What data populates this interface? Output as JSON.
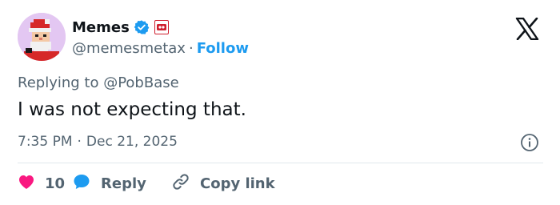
{
  "author": {
    "display_name": "Memes",
    "handle": "@memesmetax",
    "follow_label": "Follow",
    "separator": "·"
  },
  "tweet": {
    "replying_to": "Replying to @PobBase",
    "text": "I was not expecting that.",
    "time": "7:35 PM",
    "date": "Dec 21, 2025"
  },
  "actions": {
    "like_count": "10",
    "reply_label": "Reply",
    "copy_link_label": "Copy link"
  },
  "icons": {
    "verified": "verified-badge-icon",
    "affiliate": "affiliate-badge-icon",
    "logo": "x-logo-icon",
    "info": "info-icon",
    "like": "heart-icon",
    "reply": "speech-bubble-icon",
    "copy": "link-icon"
  },
  "colors": {
    "accent": "#1d9bf0",
    "like": "#f91880",
    "text": "#0f1419",
    "muted": "#536471",
    "avatar_bg": "#e3c7f2"
  }
}
